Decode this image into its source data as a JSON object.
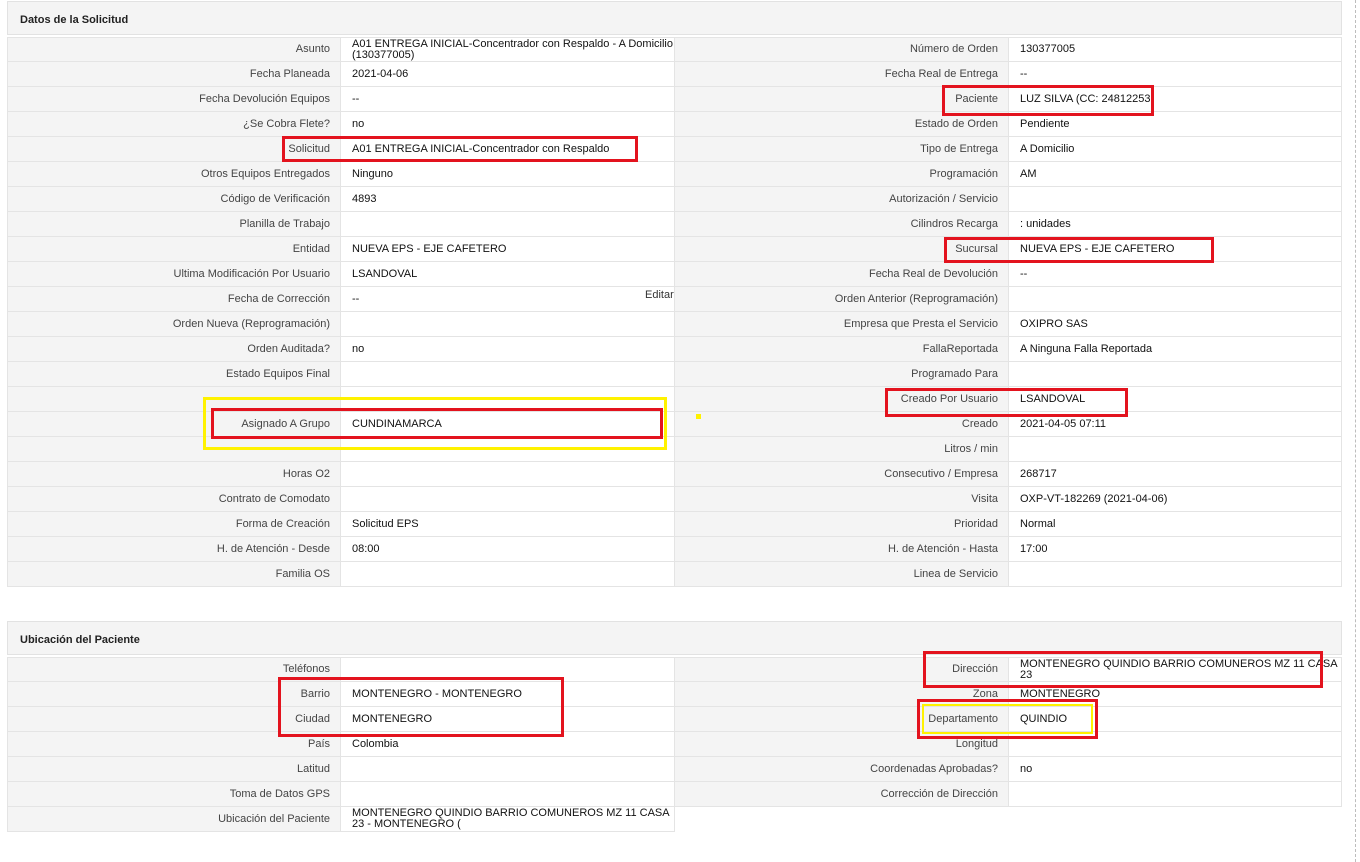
{
  "section1": {
    "title": "Datos de la Solicitud",
    "rows": [
      {
        "l_label": "Asunto",
        "l_value": "A01 ENTREGA INICIAL-Concentrador con Respaldo - A Domicilio (130377005)",
        "r_label": "Número de Orden",
        "r_value": "130377005"
      },
      {
        "l_label": "Fecha Planeada",
        "l_value": " 2021-04-06",
        "r_label": "Fecha Real de Entrega",
        "r_value": " --"
      },
      {
        "l_label": "Fecha Devolución Equipos",
        "l_value": "--",
        "r_label": "Paciente",
        "r_value": "LUZ SILVA (CC: 24812253"
      },
      {
        "l_label": "¿Se Cobra Flete?",
        "l_value": " no",
        "r_label": "Estado de Orden",
        "r_value": "Pendiente"
      },
      {
        "l_label": "Solicitud",
        "l_value": "A01 ENTREGA INICIAL-Concentrador con Respaldo",
        "r_label": "Tipo de Entrega",
        "r_value": "A Domicilio"
      },
      {
        "l_label": "Otros Equipos Entregados",
        "l_value": "Ninguno",
        "r_label": "Programación",
        "r_value": "AM"
      },
      {
        "l_label": "Código de Verificación",
        "l_value": "4893",
        "r_label": "Autorización / Servicio",
        "r_value": ""
      },
      {
        "l_label": "Planilla de Trabajo",
        "l_value": "",
        "r_label": "Cilindros Recarga",
        "r_value": ": unidades"
      },
      {
        "l_label": "Entidad",
        "l_value": "NUEVA EPS - EJE CAFETERO",
        "r_label": "Sucursal",
        "r_value": "NUEVA EPS - EJE CAFETERO"
      },
      {
        "l_label": "Ultima Modificación Por Usuario",
        "l_value": "LSANDOVAL",
        "r_label": "Fecha Real de Devolución",
        "r_value": " --"
      },
      {
        "l_label": "Fecha de Corrección",
        "l_value": " --",
        "r_label": "Orden Anterior (Reprogramación)",
        "r_value": ""
      },
      {
        "l_label": "Orden Nueva (Reprogramación)",
        "l_value": "",
        "r_label": "Empresa que Presta el Servicio",
        "r_value": "OXIPRO SAS"
      },
      {
        "l_label": "Orden Auditada?",
        "l_value": " no",
        "r_label": "FallaReportada",
        "r_value": "A Ninguna Falla Reportada"
      },
      {
        "l_label": "Estado Equipos Final",
        "l_value": "",
        "r_label": "Programado Para",
        "r_value": ""
      },
      {
        "l_label": "",
        "l_value": "",
        "r_label": "Creado Por Usuario",
        "r_value": "LSANDOVAL"
      },
      {
        "l_label": "Asignado A Grupo",
        "l_value": "CUNDINAMARCA",
        "r_label": "Creado",
        "r_value": "2021-04-05 07:11"
      },
      {
        "l_label": "",
        "l_value": "",
        "r_label": "Litros / min",
        "r_value": ""
      },
      {
        "l_label": "Horas O2",
        "l_value": "",
        "r_label": "Consecutivo / Empresa",
        "r_value": "268717"
      },
      {
        "l_label": "Contrato de Comodato",
        "l_value": "",
        "r_label": "Visita",
        "r_value": "OXP-VT-182269 (2021-04-06)"
      },
      {
        "l_label": "Forma de Creación",
        "l_value": "Solicitud EPS",
        "r_label": "Prioridad",
        "r_value": "Normal"
      },
      {
        "l_label": "H. de Atención - Desde",
        "l_value": "08:00",
        "r_label": "H. de Atención - Hasta",
        "r_value": "17:00"
      },
      {
        "l_label": "Familia OS",
        "l_value": "",
        "r_label": "Linea de Servicio",
        "r_value": ""
      }
    ]
  },
  "edit_label": "Editar",
  "section2": {
    "title": "Ubicación del Paciente",
    "rows": [
      {
        "l_label": "Teléfonos",
        "l_value": "",
        "r_label": "Dirección",
        "r_value": "MONTENEGRO QUINDIO BARRIO COMUNEROS MZ 11 CASA 23"
      },
      {
        "l_label": "Barrio",
        "l_value": "MONTENEGRO - MONTENEGRO",
        "r_label": "Zona",
        "r_value": "MONTENEGRO"
      },
      {
        "l_label": "Ciudad",
        "l_value": "MONTENEGRO",
        "r_label": "Departamento",
        "r_value": "QUINDIO"
      },
      {
        "l_label": "País",
        "l_value": "Colombia",
        "r_label": "Longitud",
        "r_value": ""
      },
      {
        "l_label": "Latitud",
        "l_value": "",
        "r_label": "Coordenadas Aprobadas?",
        "r_value": " no"
      },
      {
        "l_label": "Toma de Datos GPS",
        "l_value": "",
        "r_label": "Corrección de Dirección",
        "r_value": ""
      },
      {
        "l_label": "Ubicación del Paciente",
        "l_value": "MONTENEGRO QUINDIO BARRIO COMUNEROS MZ 11 CASA 23 - MONTENEGRO (",
        "r_label": null,
        "r_value": null
      }
    ]
  },
  "colors": {
    "highlight_red": "#e3131e",
    "highlight_yellow": "#fff200"
  }
}
